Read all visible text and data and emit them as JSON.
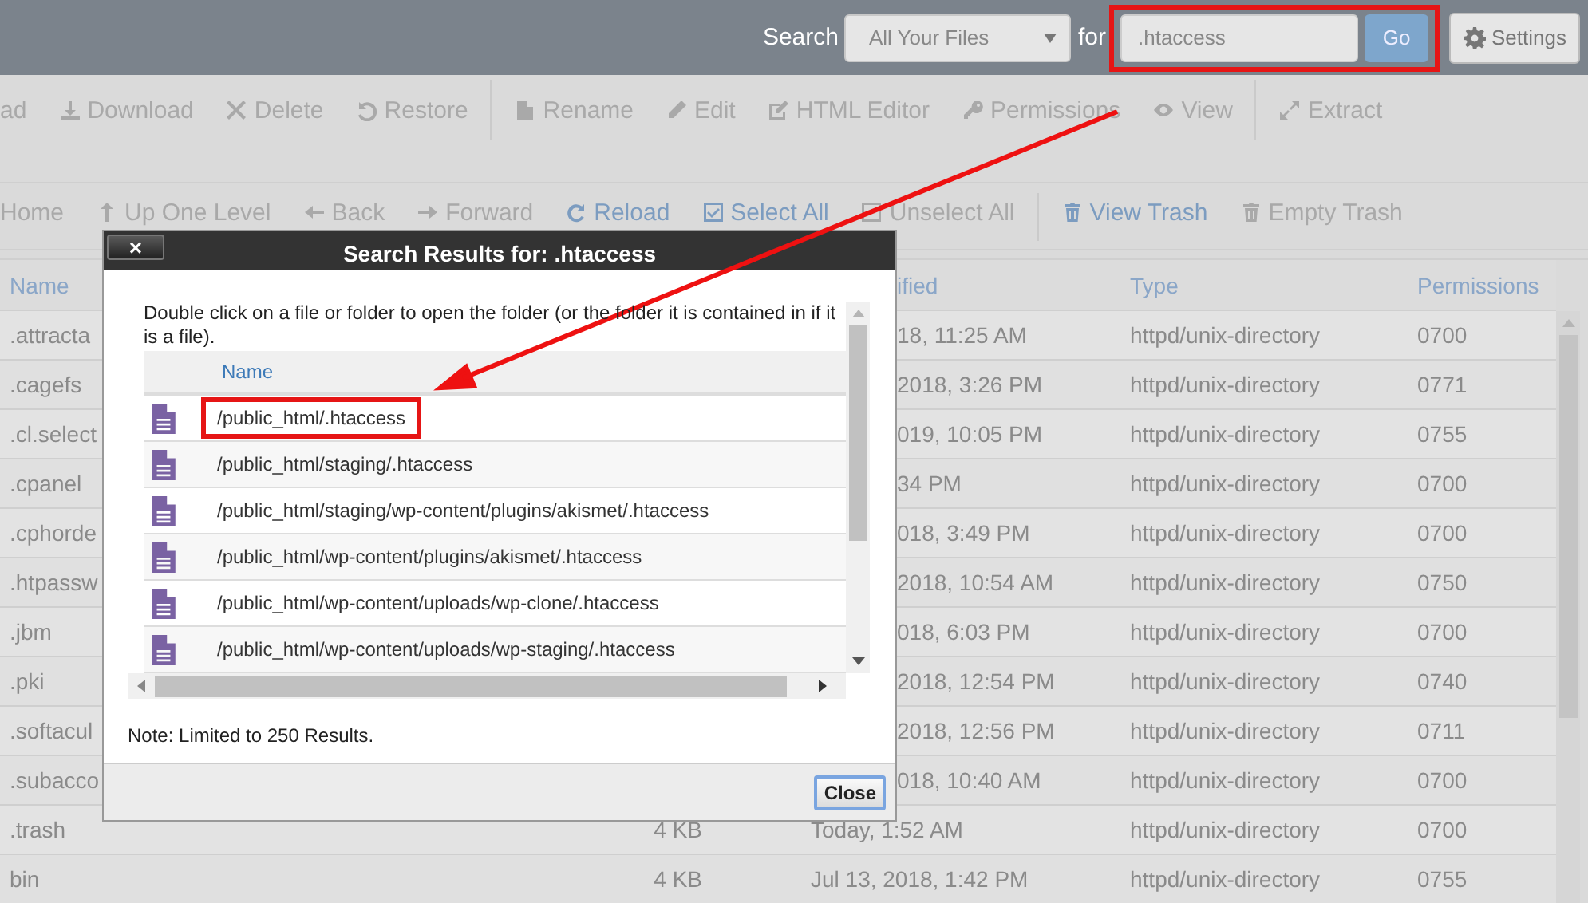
{
  "top_bar": {
    "search_label": "Search",
    "scope": "All Your Files",
    "for_label": "for",
    "query": ".htaccess",
    "query_highlighted": true,
    "go": "Go",
    "settings": "Settings"
  },
  "toolbar": {
    "groups": [
      [
        {
          "label": "ad",
          "disabled": true
        },
        {
          "label": "Download",
          "disabled": true
        },
        {
          "label": "Delete",
          "disabled": true
        },
        {
          "label": "Restore",
          "disabled": true
        }
      ],
      [
        {
          "label": "Rename",
          "disabled": true
        },
        {
          "label": "Edit",
          "disabled": true
        },
        {
          "label": "HTML Editor",
          "disabled": true
        },
        {
          "label": "Permissions",
          "disabled": true
        },
        {
          "label": "View",
          "disabled": true
        }
      ],
      [
        {
          "label": "Extract",
          "disabled": true
        }
      ]
    ]
  },
  "nav_toolbar": {
    "groups": [
      [
        {
          "label": "Home",
          "disabled": true
        },
        {
          "label": "Up One Level",
          "disabled": true
        },
        {
          "label": "Back",
          "disabled": true
        },
        {
          "label": "Forward",
          "disabled": true
        },
        {
          "label": "Reload",
          "disabled": false
        },
        {
          "label": "Select All",
          "disabled": false
        },
        {
          "label": "Unselect All",
          "disabled": true
        }
      ],
      [
        {
          "label": "View Trash",
          "disabled": false
        },
        {
          "label": "Empty Trash",
          "disabled": true
        }
      ]
    ]
  },
  "file_table": {
    "columns": [
      "Name",
      "ified",
      "Type",
      "Permissions"
    ],
    "rows": [
      {
        "name": ".attracta",
        "modified": "18, 11:25 AM",
        "type": "httpd/unix-directory",
        "permissions": "0700"
      },
      {
        "name": ".cagefs",
        "modified": "2018, 3:26 PM",
        "type": "httpd/unix-directory",
        "permissions": "0771"
      },
      {
        "name": ".cl.select",
        "modified": "019, 10:05 PM",
        "type": "httpd/unix-directory",
        "permissions": "0755"
      },
      {
        "name": ".cpanel",
        "modified": "34 PM",
        "type": "httpd/unix-directory",
        "permissions": "0700"
      },
      {
        "name": ".cphorde",
        "modified": "018, 3:49 PM",
        "type": "httpd/unix-directory",
        "permissions": "0700"
      },
      {
        "name": ".htpassw",
        "modified": "2018, 10:54 AM",
        "type": "httpd/unix-directory",
        "permissions": "0750"
      },
      {
        "name": ".jbm",
        "modified": "018, 6:03 PM",
        "type": "httpd/unix-directory",
        "permissions": "0700"
      },
      {
        "name": ".pki",
        "modified": "2018, 12:54 PM",
        "type": "httpd/unix-directory",
        "permissions": "0740"
      },
      {
        "name": ".softacul",
        "modified": "2018, 12:56 PM",
        "type": "httpd/unix-directory",
        "permissions": "0711"
      },
      {
        "name": ".subacco",
        "modified": "018, 10:40 AM",
        "type": "httpd/unix-directory",
        "permissions": "0700"
      },
      {
        "name": ".trash",
        "size": "4 KB",
        "modified": "Today, 1:52 AM",
        "type": "httpd/unix-directory",
        "permissions": "0700"
      },
      {
        "name": "bin",
        "size": "4 KB",
        "modified": "Jul 13, 2018, 1:42 PM",
        "type": "httpd/unix-directory",
        "permissions": "0755"
      }
    ]
  },
  "dialog": {
    "title": "Search Results for: .htaccess",
    "close_glyph": "×",
    "description": "Double click on a file or folder to open the folder (or the folder it is contained in if it is a file).",
    "column": "Name",
    "results": [
      {
        "path": "/public_html/.htaccess",
        "highlighted": true
      },
      {
        "path": "/public_html/staging/.htaccess",
        "highlighted": false
      },
      {
        "path": "/public_html/staging/wp-content/plugins/akismet/.htaccess",
        "highlighted": false
      },
      {
        "path": "/public_html/wp-content/plugins/akismet/.htaccess",
        "highlighted": false
      },
      {
        "path": "/public_html/wp-content/uploads/wp-clone/.htaccess",
        "highlighted": false
      },
      {
        "path": "/public_html/wp-content/uploads/wp-staging/.htaccess",
        "highlighted": false
      }
    ],
    "note": "Note: Limited to 250 Results.",
    "close_button": "Close"
  }
}
